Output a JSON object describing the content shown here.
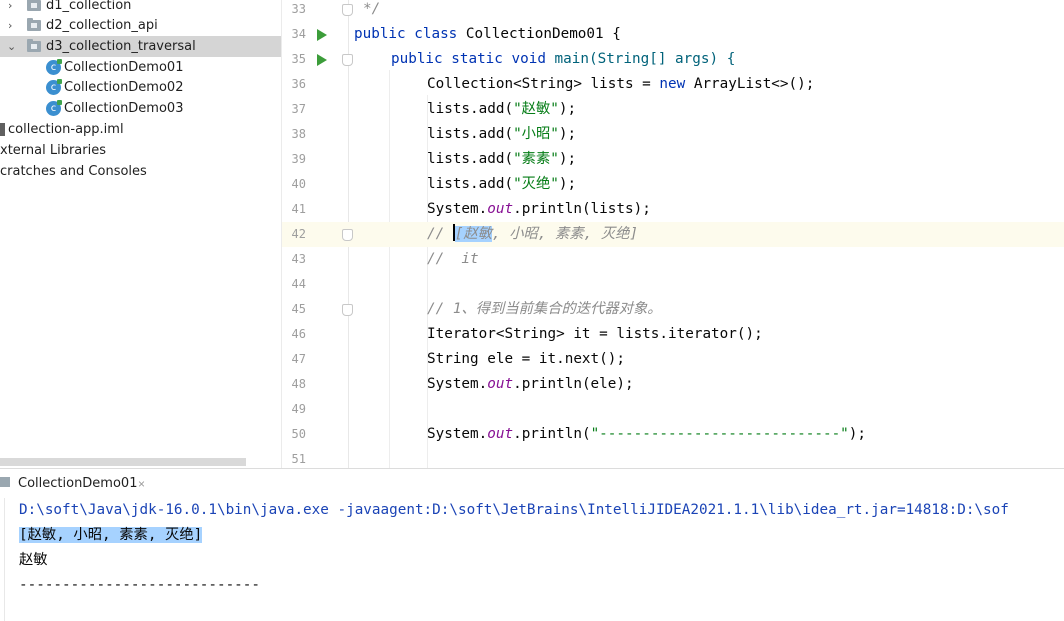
{
  "project_tree": {
    "items": [
      {
        "label": "d1_collection",
        "type": "folder"
      },
      {
        "label": "d2_collection_api",
        "type": "folder"
      },
      {
        "label": "d3_collection_traversal",
        "type": "folder"
      },
      {
        "label": "CollectionDemo01",
        "type": "class"
      },
      {
        "label": "CollectionDemo02",
        "type": "class"
      },
      {
        "label": "CollectionDemo03",
        "type": "class"
      },
      {
        "label": "collection-app.iml",
        "type": "file"
      },
      {
        "label": "xternal Libraries",
        "type": "node"
      },
      {
        "label": "cratches and Consoles",
        "type": "node"
      }
    ]
  },
  "editor": {
    "lines": [
      {
        "num": "33",
        "text": "*/"
      },
      {
        "num": "34",
        "t1": "public class ",
        "t2": "CollectionDemo01 {"
      },
      {
        "num": "35",
        "t1": "public static void ",
        "t2": "main(String[] args) {"
      },
      {
        "num": "36",
        "t1": "Collection<String> lists = ",
        "t2": "new ",
        "t3": "ArrayList<>();"
      },
      {
        "num": "37",
        "t1": "lists.add(",
        "t2": "\"赵敏\"",
        "t3": ");"
      },
      {
        "num": "38",
        "t1": "lists.add(",
        "t2": "\"小昭\"",
        "t3": ");"
      },
      {
        "num": "39",
        "t1": "lists.add(",
        "t2": "\"素素\"",
        "t3": ");"
      },
      {
        "num": "40",
        "t1": "lists.add(",
        "t2": "\"灭绝\"",
        "t3": ");"
      },
      {
        "num": "41",
        "t1": "System.",
        "t2": "out",
        "t3": ".println(lists);"
      },
      {
        "num": "42",
        "t1": "// ",
        "t2": "[赵敏",
        "t3": ", 小昭, 素素, 灭绝]"
      },
      {
        "num": "43",
        "text": "//  it"
      },
      {
        "num": "44",
        "text": ""
      },
      {
        "num": "45",
        "text": "// 1、得到当前集合的迭代器对象。"
      },
      {
        "num": "46",
        "text": "Iterator<String> it = lists.iterator();"
      },
      {
        "num": "47",
        "text": "String ele = it.next();"
      },
      {
        "num": "48",
        "t1": "System.",
        "t2": "out",
        "t3": ".println(ele);"
      },
      {
        "num": "49",
        "text": ""
      },
      {
        "num": "50",
        "t1": "System.",
        "t2": "out",
        "t3": ".println(",
        "t4": "\"----------------------------\"",
        "t5": ");"
      },
      {
        "num": "51",
        "text": ""
      }
    ]
  },
  "console": {
    "tab_label": "CollectionDemo01",
    "tab_close": "×",
    "lines": [
      "D:\\soft\\Java\\jdk-16.0.1\\bin\\java.exe -javaagent:D:\\soft\\JetBrains\\IntelliJIDEA2021.1.1\\lib\\idea_rt.jar=14818:D:\\sof",
      "[赵敏, 小昭, 素素, 灭绝]",
      "赵敏",
      "----------------------------"
    ]
  },
  "colors": {
    "keyword": "#0033b3",
    "string": "#067d17",
    "comment": "#8c8c8c",
    "static_field": "#871094",
    "selection": "#a6d2ff",
    "run_icon": "#3c9d3a"
  }
}
